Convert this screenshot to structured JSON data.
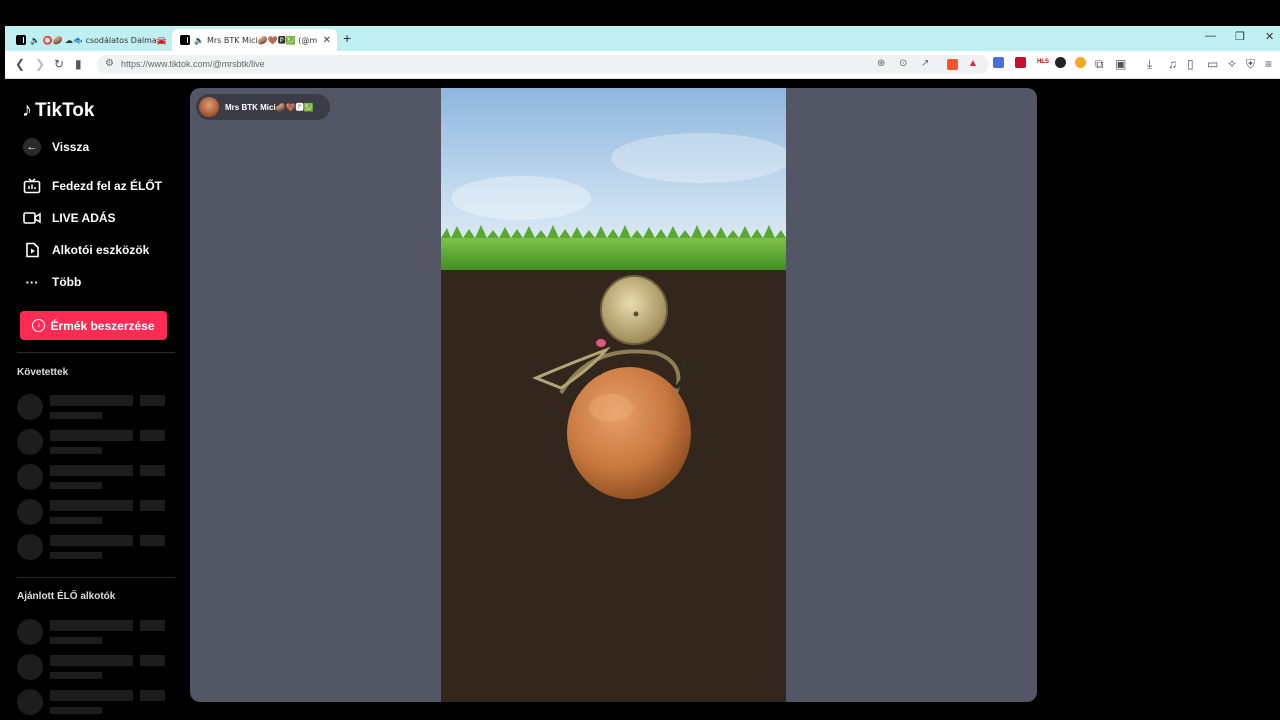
{
  "browser": {
    "tabs": [
      {
        "title": "🔈 ⭕🥔 ☁🐟 csodálatos Dalma🚘🏂",
        "active": false
      },
      {
        "title": "Mrs BTK Mici🥔🤎🅿💹 (@m",
        "active": true
      }
    ],
    "new_tab_symbol": "+",
    "window_controls": [
      "—",
      "❐",
      "✕"
    ],
    "url": "https://www.tiktok.com/@mrsbtk/live"
  },
  "sidebar": {
    "logo": "TikTok",
    "back_label": "Vissza",
    "items": [
      {
        "label": "Fedezd fel az ÉLŐT",
        "icon": "live-tv-icon"
      },
      {
        "label": "LIVE ADÁS",
        "icon": "video-camera-icon"
      },
      {
        "label": "Alkotói eszközök",
        "icon": "creator-tools-icon"
      },
      {
        "label": "Több",
        "icon": "more-dots-icon"
      }
    ],
    "coin_button": "Érmék beszerzése",
    "following_title": "Követettek",
    "recommended_title": "Ajánlott ÉLŐ alkotók"
  },
  "stream": {
    "host_name": "Mrs BTK Mici🥔🤎🅿💹"
  },
  "colors": {
    "accent": "#fe2c55",
    "tabbar": "#bfeff0",
    "stage_bg": "#535665"
  }
}
